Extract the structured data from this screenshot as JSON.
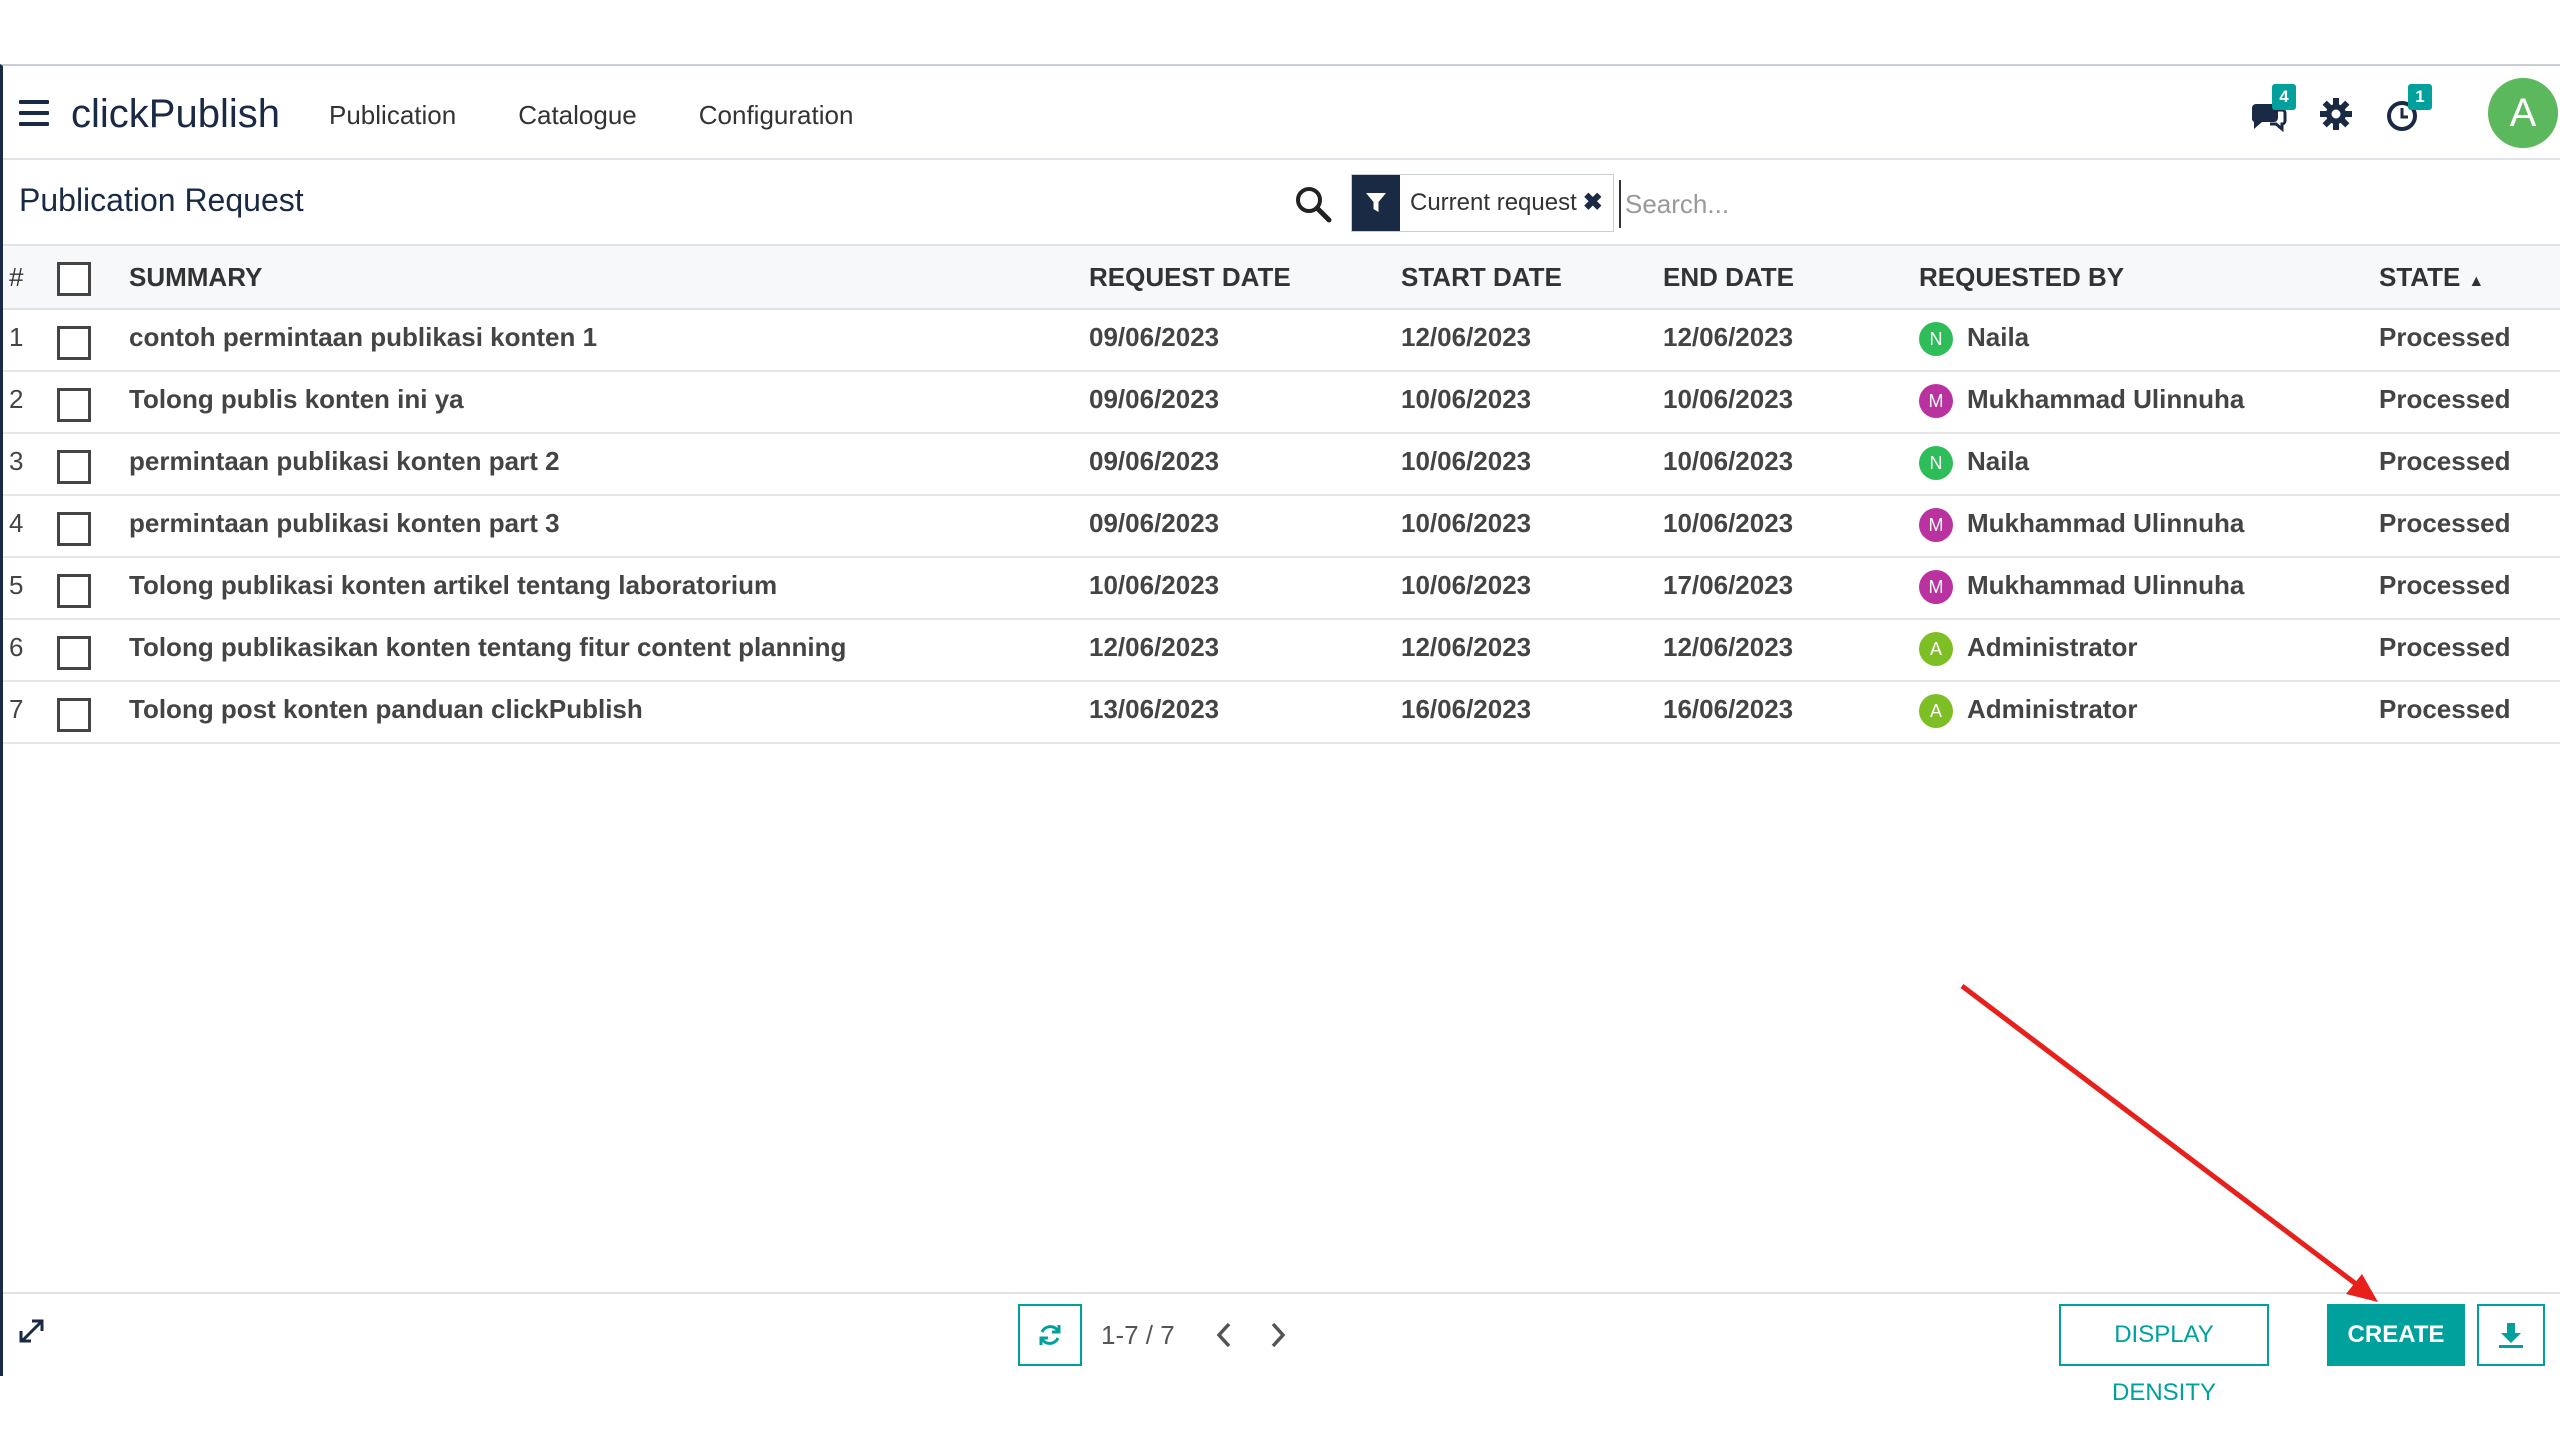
{
  "navbar": {
    "brand": "clickPublish",
    "menu": [
      "Publication",
      "Catalogue",
      "Configuration"
    ],
    "messages_badge": "4",
    "activity_badge": "1",
    "avatar_initial": "A"
  },
  "control_panel": {
    "breadcrumb": "Publication Request",
    "facet_label": "Current request",
    "search_placeholder": "Search..."
  },
  "table": {
    "headers": {
      "num": "#",
      "summary": "SUMMARY",
      "request_date": "REQUEST DATE",
      "start_date": "START DATE",
      "end_date": "END DATE",
      "requested_by": "REQUESTED BY",
      "state": "STATE"
    },
    "rows": [
      {
        "num": "1",
        "summary": "contoh permintaan publikasi konten 1",
        "request_date": "09/06/2023",
        "start_date": "12/06/2023",
        "end_date": "12/06/2023",
        "requester_initial": "N",
        "requester_color": "#2ebd59",
        "requested_by": "Naila",
        "state": "Processed"
      },
      {
        "num": "2",
        "summary": "Tolong publis konten ini ya",
        "request_date": "09/06/2023",
        "start_date": "10/06/2023",
        "end_date": "10/06/2023",
        "requester_initial": "M",
        "requester_color": "#b9329f",
        "requested_by": "Mukhammad Ulinnuha",
        "state": "Processed"
      },
      {
        "num": "3",
        "summary": "permintaan publikasi konten part 2",
        "request_date": "09/06/2023",
        "start_date": "10/06/2023",
        "end_date": "10/06/2023",
        "requester_initial": "N",
        "requester_color": "#2ebd59",
        "requested_by": "Naila",
        "state": "Processed"
      },
      {
        "num": "4",
        "summary": "permintaan publikasi konten part 3",
        "request_date": "09/06/2023",
        "start_date": "10/06/2023",
        "end_date": "10/06/2023",
        "requester_initial": "M",
        "requester_color": "#b9329f",
        "requested_by": "Mukhammad Ulinnuha",
        "state": "Processed"
      },
      {
        "num": "5",
        "summary": "Tolong publikasi konten artikel tentang laboratorium",
        "request_date": "10/06/2023",
        "start_date": "10/06/2023",
        "end_date": "17/06/2023",
        "requester_initial": "M",
        "requester_color": "#b9329f",
        "requested_by": "Mukhammad Ulinnuha",
        "state": "Processed"
      },
      {
        "num": "6",
        "summary": "Tolong publikasikan konten tentang fitur content planning",
        "request_date": "12/06/2023",
        "start_date": "12/06/2023",
        "end_date": "12/06/2023",
        "requester_initial": "A",
        "requester_color": "#7fbf26",
        "requested_by": "Administrator",
        "state": "Processed"
      },
      {
        "num": "7",
        "summary": "Tolong post konten panduan clickPublish",
        "request_date": "13/06/2023",
        "start_date": "16/06/2023",
        "end_date": "16/06/2023",
        "requester_initial": "A",
        "requester_color": "#7fbf26",
        "requested_by": "Administrator",
        "state": "Processed"
      }
    ]
  },
  "footer": {
    "pager_value": "1-7 / 7",
    "display_density_label": "DISPLAY DENSITY",
    "create_label": "CREATE"
  },
  "colors": {
    "accent": "#00a09d",
    "navy": "#1a2a44",
    "annotation_arrow": "#e8201c"
  },
  "icons": [
    "hamburger-icon",
    "messages-icon",
    "gear-icon",
    "activity-icon",
    "search-icon",
    "filter-icon",
    "close-icon",
    "sort-up-icon",
    "expand-icon",
    "refresh-icon",
    "chevron-left-icon",
    "chevron-right-icon",
    "download-icon"
  ]
}
